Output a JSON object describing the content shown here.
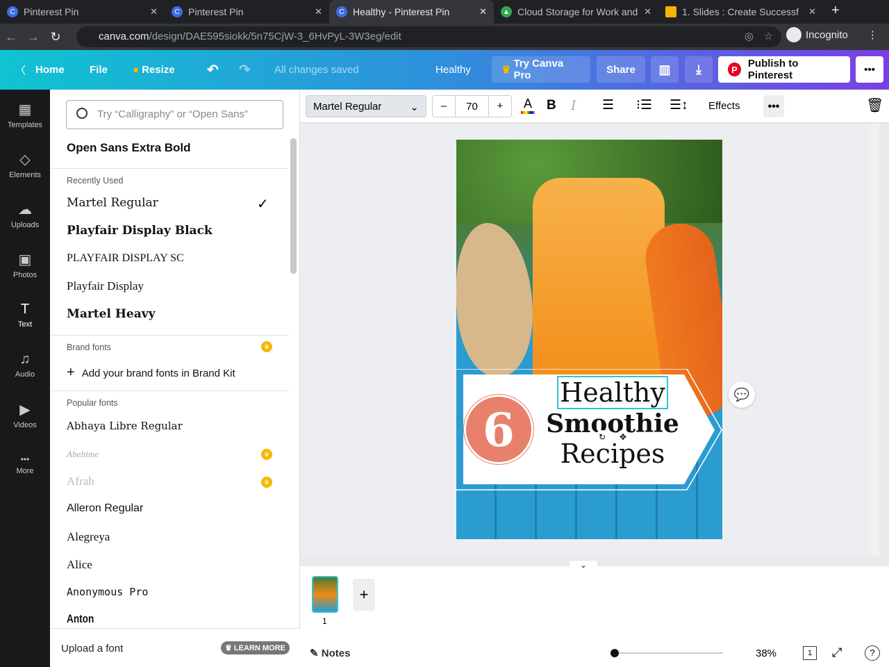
{
  "browser": {
    "tabs": [
      {
        "title": "Pinterest Pin"
      },
      {
        "title": "Pinterest Pin"
      },
      {
        "title": "Healthy - Pinterest Pin",
        "active": true
      },
      {
        "title": "Cloud Storage for Work and"
      },
      {
        "title": "1. Slides : Create Successf"
      }
    ],
    "url_host": "canva.com",
    "url_path": "/design/DAE595siokk/5n75CjW-3_6HvPyL-3W3eg/edit",
    "incognito": "Incognito"
  },
  "topbar": {
    "home": "Home",
    "file": "File",
    "resize": "Resize",
    "status": "All changes saved",
    "title": "Healthy",
    "try_pro": "Try Canva Pro",
    "share": "Share",
    "publish": "Publish to Pinterest"
  },
  "toolbar": {
    "font": "Martel Regular",
    "size": "70",
    "minus": "–",
    "plus": "+",
    "effects": "Effects"
  },
  "rail": [
    {
      "label": "Templates",
      "icon": "▦"
    },
    {
      "label": "Elements",
      "icon": "◇"
    },
    {
      "label": "Uploads",
      "icon": "☁"
    },
    {
      "label": "Photos",
      "icon": "▣"
    },
    {
      "label": "Text",
      "icon": "T"
    },
    {
      "label": "Audio",
      "icon": "♫"
    },
    {
      "label": "Videos",
      "icon": "▶"
    },
    {
      "label": "More",
      "icon": "•••"
    }
  ],
  "panel": {
    "search_placeholder": "Try “Calligraphy” or “Open Sans”",
    "featured": "Open Sans Extra Bold",
    "recently_used": "Recently Used",
    "recent": [
      "Martel Regular",
      "Playfair Display Black",
      "PLAYFAIR DISPLAY SC",
      "Playfair Display",
      "Martel Heavy"
    ],
    "brand_fonts": "Brand fonts",
    "add_brand": "Add your brand fonts in Brand Kit",
    "popular": "Popular fonts",
    "popular_fonts": [
      "Abhaya Libre Regular",
      "Abeltime",
      "Afrah",
      "Alleron Regular",
      "Alegreya",
      "Alice",
      "Anonymous Pro",
      "Anton"
    ],
    "upload": "Upload a font",
    "learn_more": "LEARN MORE"
  },
  "design": {
    "number": "6",
    "line1": "Healthy",
    "line2": "Smoothie",
    "line3": "Recipes"
  },
  "pages": {
    "page_number": "1"
  },
  "footer": {
    "notes": "Notes",
    "zoom": "38%",
    "page_count": "1"
  }
}
